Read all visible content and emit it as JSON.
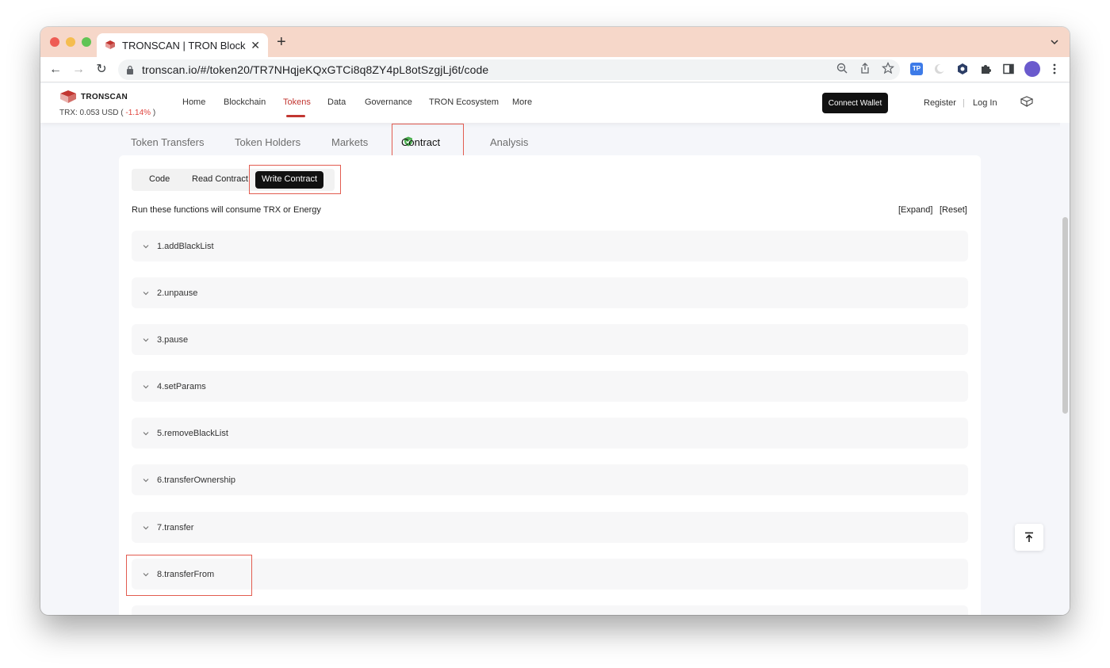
{
  "browser": {
    "tab_title": "TRONSCAN | TRON BlockChai",
    "url": "tronscan.io/#/token20/TR7NHqjeKQxGTCi8q8ZY4pL8otSzgjLj6t/code",
    "ext_tp": "TP"
  },
  "header": {
    "brand": "TRONSCAN",
    "price_prefix": "TRX: 0.053 USD ( ",
    "price_change": "-1.14%",
    "price_suffix": " )",
    "nav": [
      "Home",
      "Blockchain",
      "Tokens",
      "Data",
      "Governance",
      "TRON Ecosystem",
      "More"
    ],
    "connect_wallet": "Connect Wallet",
    "register": "Register",
    "separator": "|",
    "login": "Log In"
  },
  "token_tabs": [
    "Token Transfers",
    "Token Holders",
    "Markets",
    "Contract",
    "Analysis"
  ],
  "contract_tabs": [
    "Code",
    "Read Contract",
    "Write Contract"
  ],
  "notice": "Run these functions will consume TRX or Energy",
  "expand_label": "[Expand]",
  "reset_label": "[Reset]",
  "functions": [
    "1.addBlackList",
    "2.unpause",
    "3.pause",
    "4.setParams",
    "5.removeBlackList",
    "6.transferOwnership",
    "7.transfer",
    "8.transferFrom"
  ],
  "colors": {
    "accent_red": "#c23631",
    "highlight_box": "#e25c50",
    "verified_green": "#4caf50",
    "tab_strip": "#f6d7c9"
  }
}
